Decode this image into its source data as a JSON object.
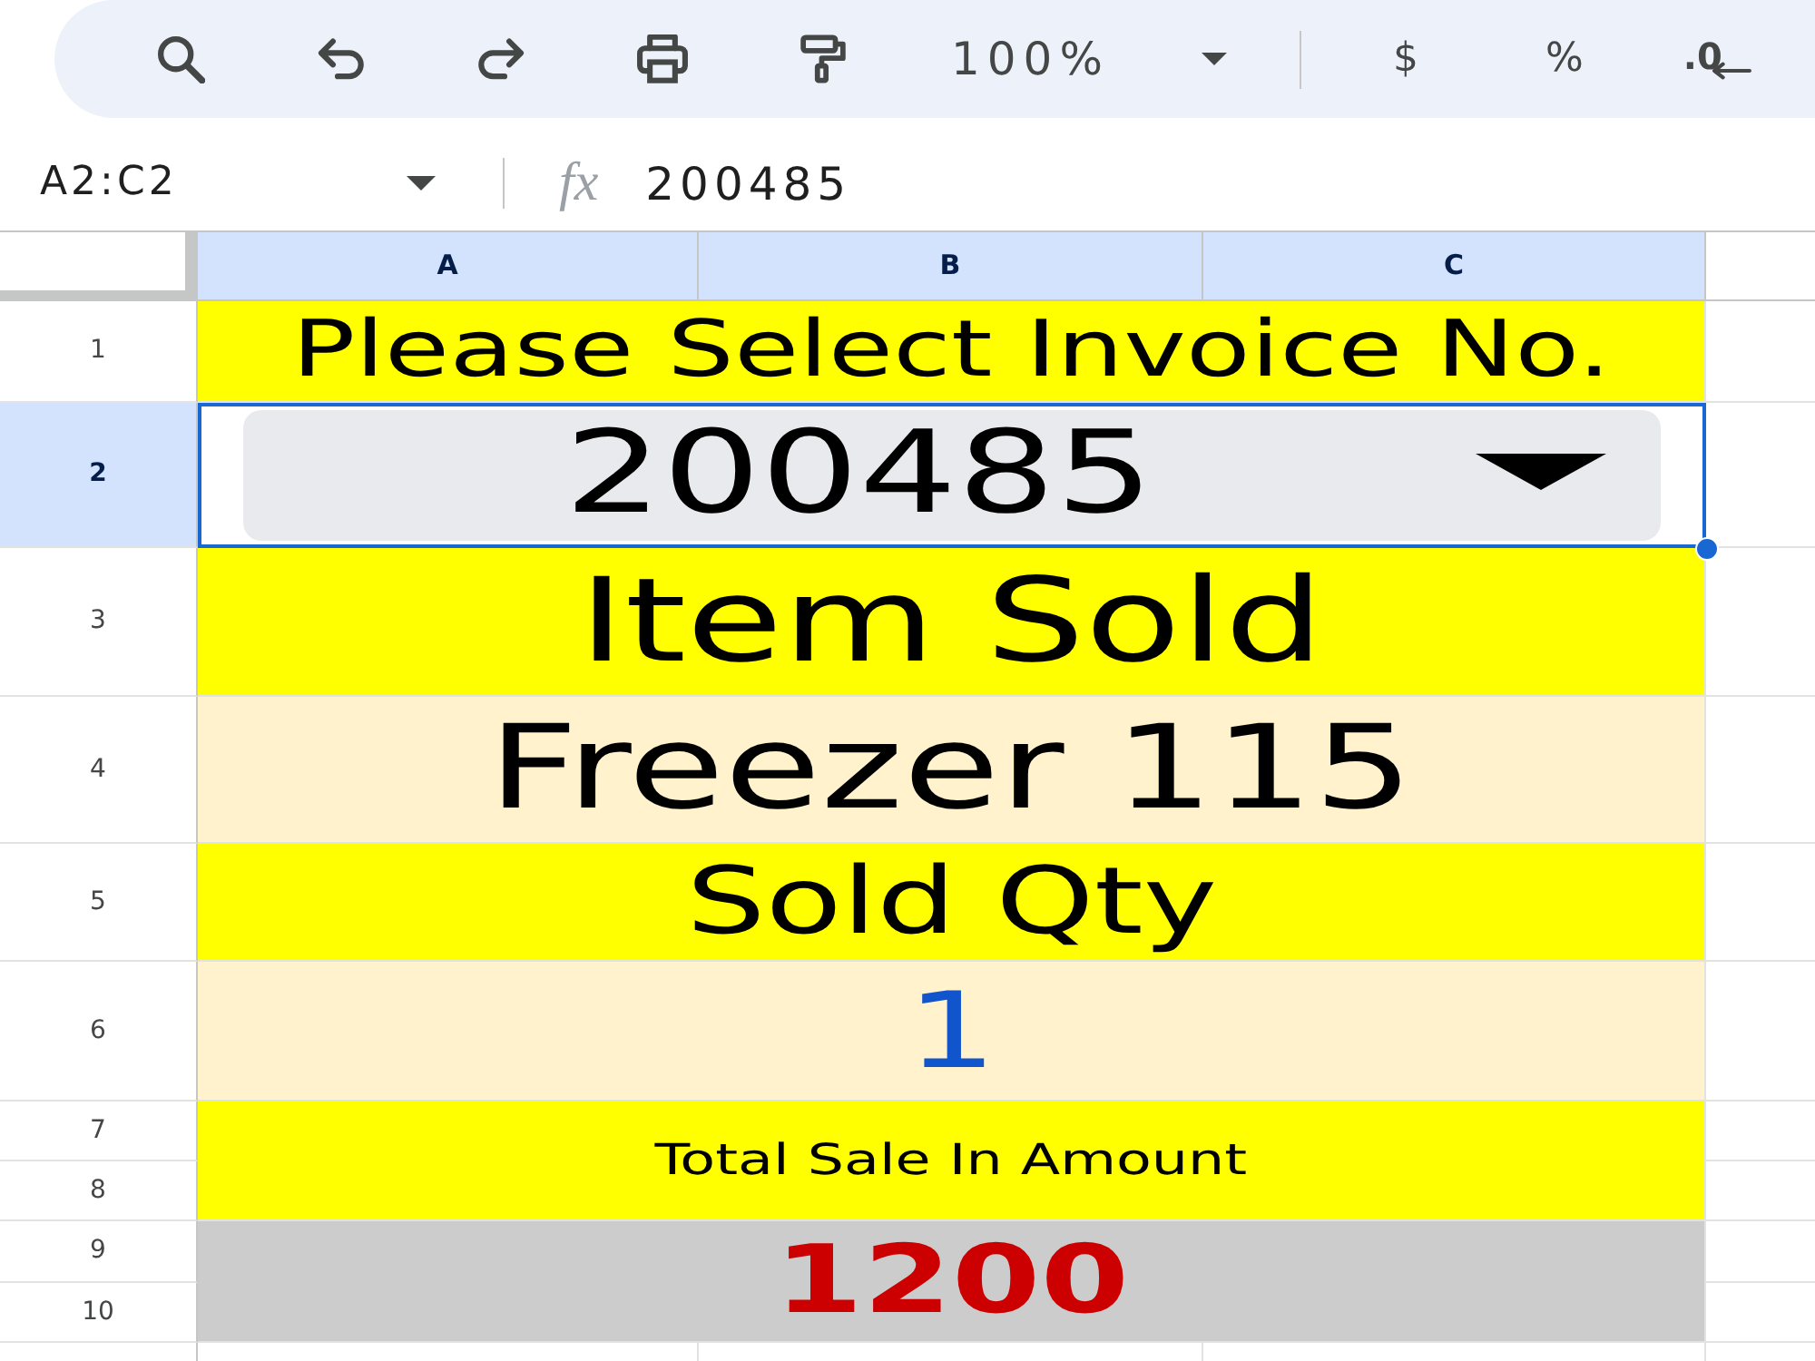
{
  "toolbar": {
    "zoom": "100%",
    "format_buttons": [
      {
        "kind": "currency",
        "label": "$"
      },
      {
        "kind": "percent",
        "label": "%"
      },
      {
        "kind": "decrease_decimal",
        "label": ".0"
      }
    ]
  },
  "formula_bar": {
    "name_box": "A2:C2",
    "function_label": "fx",
    "value": "200485"
  },
  "sheet": {
    "columns": [
      {
        "label": "A",
        "selected": true
      },
      {
        "label": "B",
        "selected": true
      },
      {
        "label": "C",
        "selected": true
      }
    ],
    "rows": [
      {
        "label": "1",
        "selected": false,
        "cell": {
          "kind": "heading",
          "text": "Please Select Invoice No.",
          "color": "#000000",
          "selected": false
        }
      },
      {
        "label": "2",
        "selected": true,
        "cell": {
          "kind": "dropdown",
          "text": "200485",
          "color": "#000000",
          "selected": true
        }
      },
      {
        "label": "3",
        "selected": false,
        "cell": {
          "kind": "heading",
          "text": "Item Sold",
          "color": "#000000",
          "selected": false
        }
      },
      {
        "label": "4",
        "selected": false,
        "cell": {
          "kind": "value",
          "text": "Freezer 115",
          "color": "#000000",
          "selected": false
        }
      },
      {
        "label": "5",
        "selected": false,
        "cell": {
          "kind": "heading",
          "text": "Sold Qty",
          "color": "#000000",
          "selected": false
        }
      },
      {
        "label": "6",
        "selected": false,
        "cell": {
          "kind": "value",
          "text": "1",
          "color": "#1155cc",
          "selected": false
        }
      },
      {
        "label": "7",
        "selected": false,
        "cell": {
          "kind": "heading",
          "text": "Total Sale In Amount",
          "color": "#000000",
          "selected": false
        }
      },
      {
        "label": "8",
        "selected": false
      },
      {
        "label": "9",
        "selected": false,
        "cell": {
          "kind": "total",
          "text": "1200",
          "color": "#cc0000",
          "selected": false
        }
      },
      {
        "label": "10",
        "selected": false
      }
    ]
  }
}
